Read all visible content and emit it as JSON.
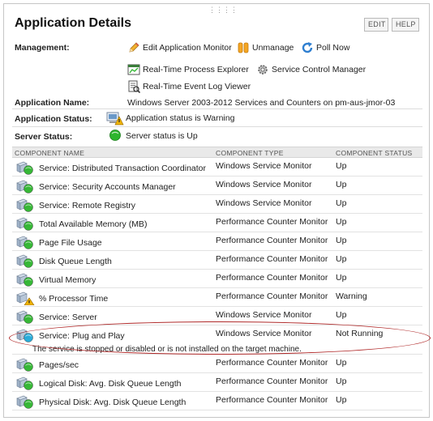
{
  "header": {
    "title": "Application Details",
    "edit_label": "EDIT",
    "help_label": "HELP"
  },
  "management": {
    "label": "Management:",
    "actions": [
      {
        "label": "Edit Application Monitor",
        "icon": "pencil-icon"
      },
      {
        "label": "Unmanage",
        "icon": "pause-icon"
      },
      {
        "label": "Poll Now",
        "icon": "refresh-icon"
      },
      {
        "label": "Real-Time Process Explorer",
        "icon": "process-explorer-icon"
      },
      {
        "label": "Service Control Manager",
        "icon": "gear-icon"
      },
      {
        "label": "Real-Time Event Log Viewer",
        "icon": "event-log-icon"
      }
    ]
  },
  "info": {
    "app_name_label": "Application Name:",
    "app_name_value": "Windows Server 2003-2012 Services and Counters on pm-aus-jmor-03",
    "app_status_label": "Application Status:",
    "app_status_value": "Application status is Warning",
    "server_status_label": "Server Status:",
    "server_status_value": "Server status is Up"
  },
  "table": {
    "headers": [
      "COMPONENT NAME",
      "COMPONENT TYPE",
      "COMPONENT STATUS"
    ],
    "rows": [
      {
        "name": "Service: Distributed Transaction Coordinator",
        "type": "Windows Service Monitor",
        "status": "Up",
        "state": "up"
      },
      {
        "name": "Service: Security Accounts Manager",
        "type": "Windows Service Monitor",
        "status": "Up",
        "state": "up"
      },
      {
        "name": "Service: Remote Registry",
        "type": "Windows Service Monitor",
        "status": "Up",
        "state": "up"
      },
      {
        "name": "Total Available Memory (MB)",
        "type": "Performance Counter Monitor",
        "status": "Up",
        "state": "up"
      },
      {
        "name": "Page File Usage",
        "type": "Performance Counter Monitor",
        "status": "Up",
        "state": "up"
      },
      {
        "name": "Disk Queue Length",
        "type": "Performance Counter Monitor",
        "status": "Up",
        "state": "up"
      },
      {
        "name": "Virtual Memory",
        "type": "Performance Counter Monitor",
        "status": "Up",
        "state": "up"
      },
      {
        "name": "% Processor Time",
        "type": "Performance Counter Monitor",
        "status": "Warning",
        "state": "warning"
      },
      {
        "name": "Service: Server",
        "type": "Windows Service Monitor",
        "status": "Up",
        "state": "up"
      },
      {
        "name": "Service: Plug and Play",
        "type": "Windows Service Monitor",
        "status": "Not Running",
        "state": "notrunning"
      },
      {
        "name": "Pages/sec",
        "type": "Performance Counter Monitor",
        "status": "Up",
        "state": "up"
      },
      {
        "name": "Logical Disk: Avg. Disk Queue Length",
        "type": "Performance Counter Monitor",
        "status": "Up",
        "state": "up"
      },
      {
        "name": "Physical Disk: Avg. Disk Queue Length",
        "type": "Performance Counter Monitor",
        "status": "Up",
        "state": "up"
      }
    ],
    "plug_and_play_message": "The service is stopped or disabled or is not installed on the target machine."
  },
  "colors": {
    "up": "#2db52d",
    "warning": "#f0b400",
    "notrunning": "#20a8d8",
    "highlight": "#b02a2a"
  }
}
